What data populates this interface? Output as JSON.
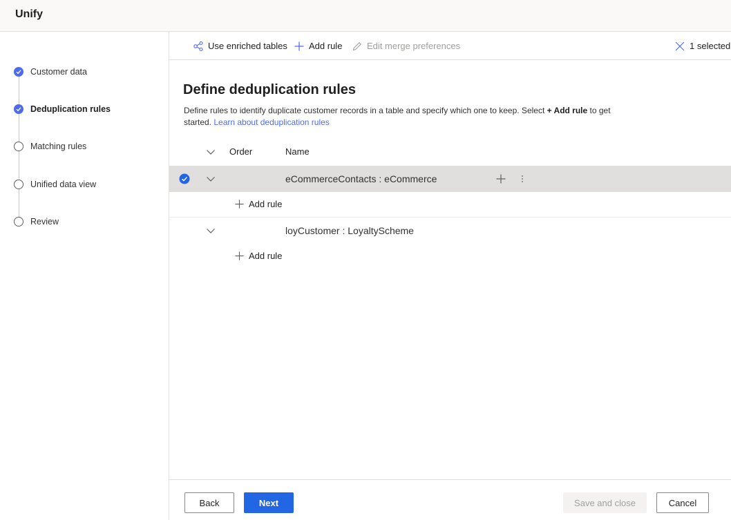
{
  "app": {
    "title": "Unify"
  },
  "steps": [
    {
      "label": "Customer data",
      "status": "complete"
    },
    {
      "label": "Deduplication rules",
      "status": "current"
    },
    {
      "label": "Matching rules",
      "status": "pending"
    },
    {
      "label": "Unified data view",
      "status": "pending"
    },
    {
      "label": "Review",
      "status": "pending"
    }
  ],
  "commandbar": {
    "enriched_label": "Use enriched tables",
    "add_rule_label": "Add rule",
    "edit_merge_label": "Edit merge preferences",
    "selected_label": "1 selected"
  },
  "main": {
    "title": "Define deduplication rules",
    "desc_part1": "Define rules to identify duplicate customer records in a table and specify which one to keep. Select ",
    "desc_bold": "+ Add rule",
    "desc_part2": " to get started. ",
    "learn_link": "Learn about deduplication rules"
  },
  "table": {
    "headers": {
      "order": "Order",
      "name": "Name"
    },
    "groups": [
      {
        "name": "eCommerceContacts : eCommerce",
        "selected": true,
        "add_rule_label": "Add rule"
      },
      {
        "name": "loyCustomer : LoyaltyScheme",
        "selected": false,
        "add_rule_label": "Add rule"
      }
    ]
  },
  "footer": {
    "back_label": "Back",
    "next_label": "Next",
    "save_close_label": "Save and close",
    "cancel_label": "Cancel"
  },
  "colors": {
    "accent": "#4f6bed",
    "primary_button": "#2266e3",
    "selected_row": "#e1dfdd"
  }
}
